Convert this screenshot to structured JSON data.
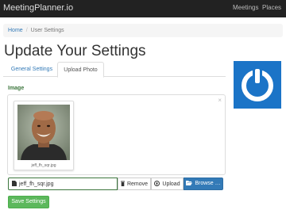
{
  "navbar": {
    "brand": "MeetingPlanner.io",
    "links": [
      "Meetings",
      "Places"
    ]
  },
  "breadcrumb": {
    "home": "Home",
    "separator": "/",
    "current": "User Settings"
  },
  "page": {
    "title": "Update Your Settings"
  },
  "tabs": [
    {
      "label": "General Settings",
      "active": false
    },
    {
      "label": "Upload Photo",
      "active": true
    }
  ],
  "form": {
    "image_label": "Image",
    "preview": {
      "caption": "jeff_fh_sqr.jpg",
      "close": "×"
    },
    "file_value": "jeff_fh_sqr.jpg",
    "remove_label": "Remove",
    "upload_label": "Upload",
    "browse_label": "Browse …",
    "save_label": "Save Settings"
  },
  "icons": {
    "logo": "power-icon",
    "remove": "trash-icon",
    "upload": "upload-circle-icon",
    "browse": "folder-open-icon",
    "file": "file-icon"
  },
  "colors": {
    "navbar": "#222222",
    "link": "#337ab7",
    "success": "#5cb85c",
    "label_green": "#3c763d",
    "logo_bg": "#1b74c7"
  }
}
